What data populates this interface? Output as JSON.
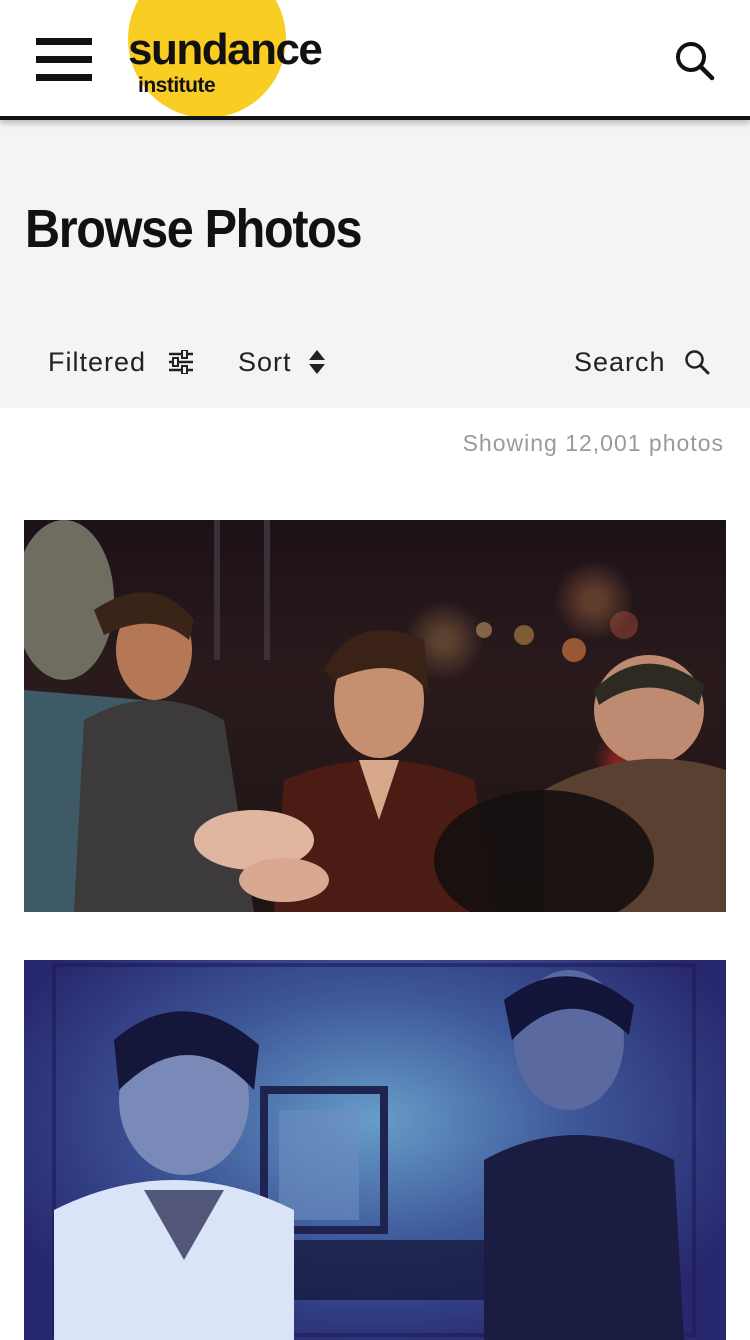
{
  "header": {
    "logo_word": "sundance",
    "logo_sub": "institute",
    "brand_yellow": "#f9cd22",
    "menu_icon": "hamburger-menu-icon",
    "search_icon": "search-icon"
  },
  "hero": {
    "title": "Browse Photos"
  },
  "toolbar": {
    "filter_label": "Filtered",
    "filter_icon": "sliders-icon",
    "sort_label": "Sort",
    "sort_icon": "sort-arrows-icon",
    "search_label": "Search",
    "search_icon": "search-icon"
  },
  "results": {
    "count_text": "Showing 12,001 photos"
  },
  "photos": [
    {
      "kind": "event-photo",
      "tone": "warm-dark-crowd"
    },
    {
      "kind": "event-photo",
      "tone": "blue-projected-screen"
    }
  ]
}
